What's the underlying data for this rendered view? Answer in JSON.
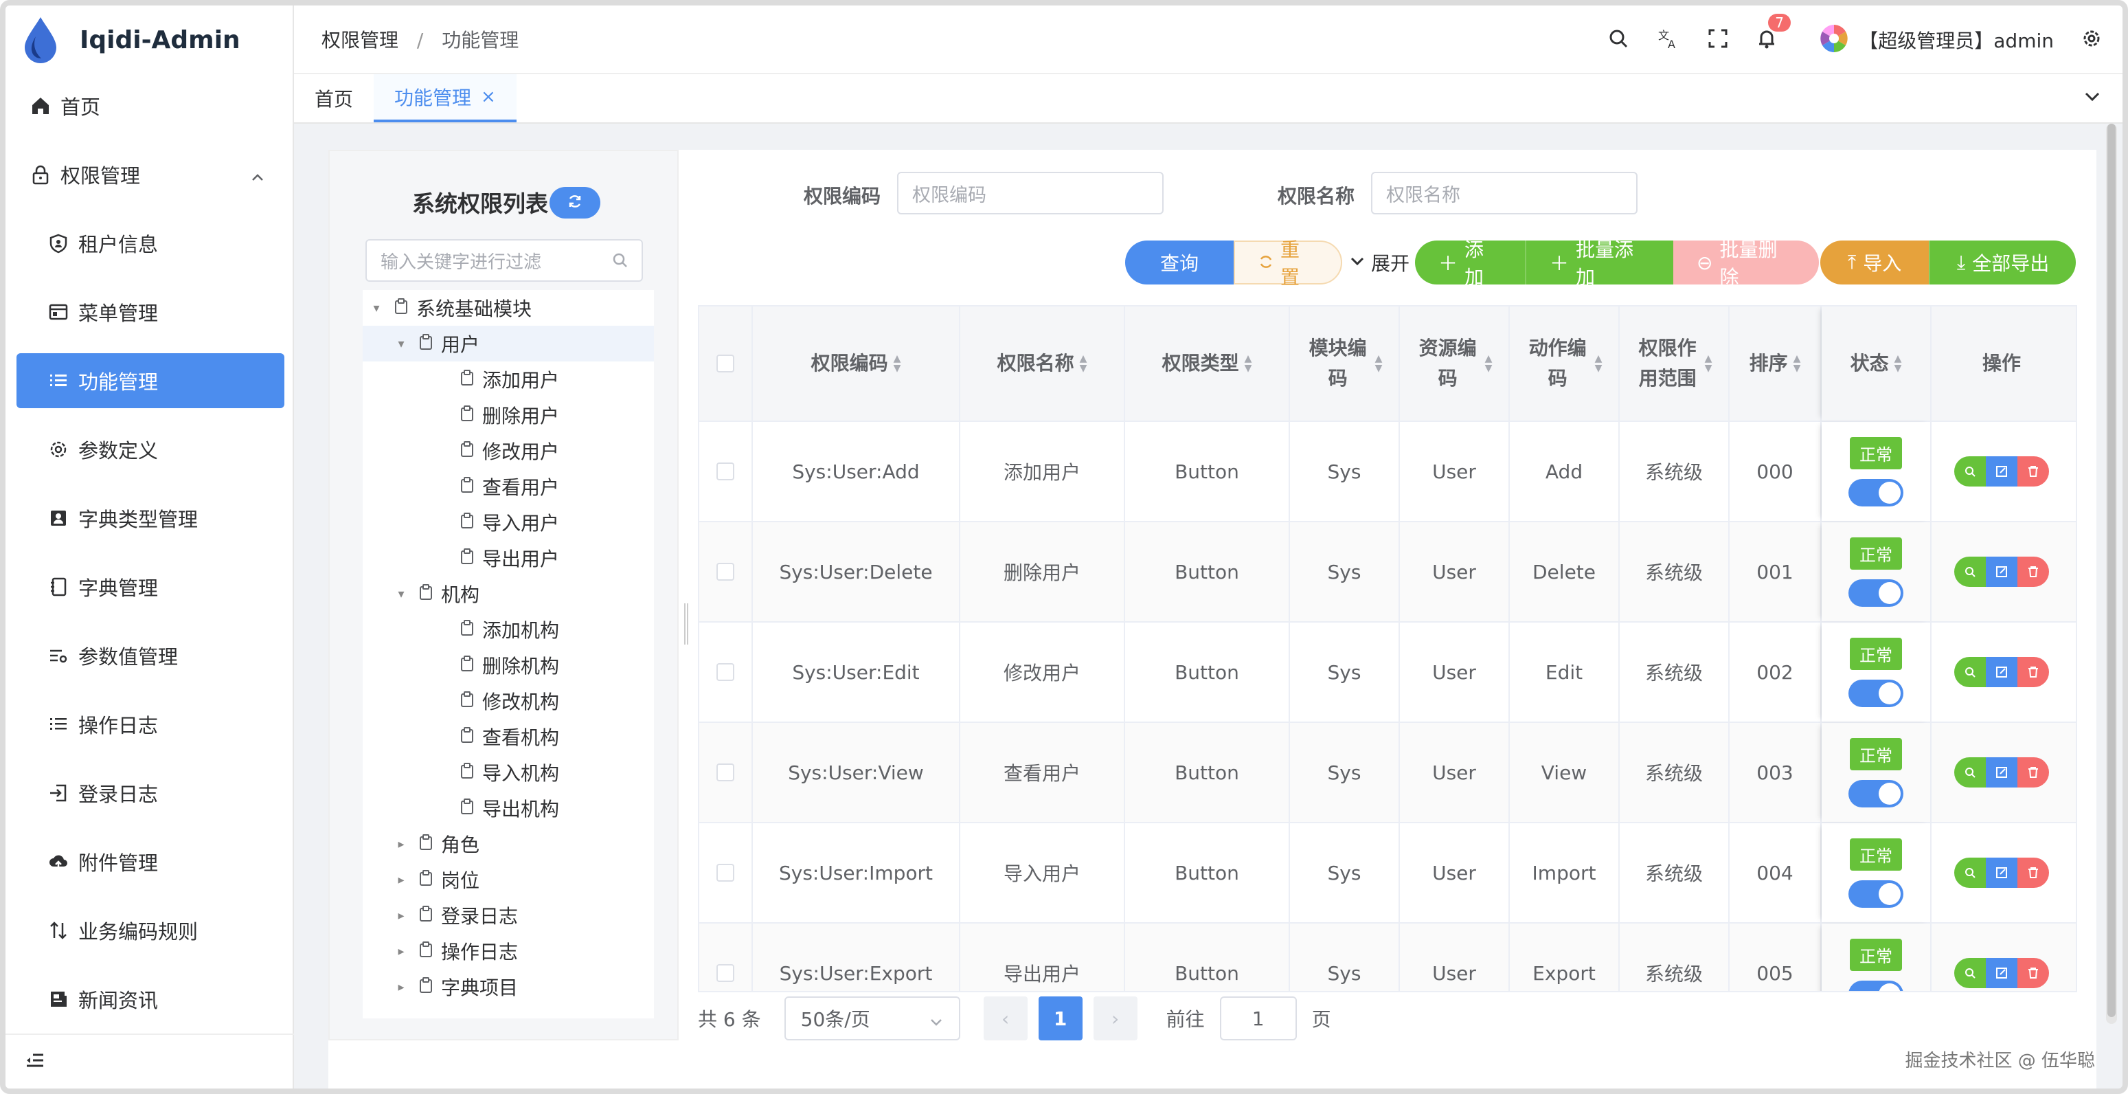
{
  "app": {
    "title": "Iqidi-Admin"
  },
  "sidebar": {
    "items": [
      {
        "label": "首页",
        "icon": "home-icon"
      },
      {
        "label": "权限管理",
        "icon": "lock-icon"
      },
      {
        "label": "租户信息",
        "icon": "shield-icon"
      },
      {
        "label": "菜单管理",
        "icon": "window-icon"
      },
      {
        "label": "功能管理",
        "icon": "list-icon"
      },
      {
        "label": "参数定义",
        "icon": "gear-icon"
      },
      {
        "label": "字典类型管理",
        "icon": "idcard-icon"
      },
      {
        "label": "字典管理",
        "icon": "notebook-icon"
      },
      {
        "label": "参数值管理",
        "icon": "setting-list-icon"
      },
      {
        "label": "操作日志",
        "icon": "list-icon"
      },
      {
        "label": "登录日志",
        "icon": "login-icon"
      },
      {
        "label": "附件管理",
        "icon": "cloud-upload-icon"
      },
      {
        "label": "业务编码规则",
        "icon": "sort-icon"
      },
      {
        "label": "新闻资讯",
        "icon": "news-icon"
      }
    ]
  },
  "header": {
    "breadcrumb": [
      "权限管理",
      "功能管理"
    ],
    "separator": "/",
    "notification_count": "7",
    "user": "【超级管理员】admin"
  },
  "tabs": [
    {
      "label": "首页"
    },
    {
      "label": "功能管理",
      "close": "×"
    }
  ],
  "tree_panel": {
    "title": "系统权限列表",
    "filter_placeholder": "输入关键字进行过滤",
    "nodes": [
      {
        "label": "系统基础模块",
        "level": 0,
        "arrow": "▾"
      },
      {
        "label": "用户",
        "level": 1,
        "arrow": "▾",
        "selected": true
      },
      {
        "label": "添加用户",
        "level": 2,
        "arrow": ""
      },
      {
        "label": "删除用户",
        "level": 2,
        "arrow": ""
      },
      {
        "label": "修改用户",
        "level": 2,
        "arrow": ""
      },
      {
        "label": "查看用户",
        "level": 2,
        "arrow": ""
      },
      {
        "label": "导入用户",
        "level": 2,
        "arrow": ""
      },
      {
        "label": "导出用户",
        "level": 2,
        "arrow": ""
      },
      {
        "label": "机构",
        "level": 1,
        "arrow": "▾"
      },
      {
        "label": "添加机构",
        "level": 2,
        "arrow": ""
      },
      {
        "label": "删除机构",
        "level": 2,
        "arrow": ""
      },
      {
        "label": "修改机构",
        "level": 2,
        "arrow": ""
      },
      {
        "label": "查看机构",
        "level": 2,
        "arrow": ""
      },
      {
        "label": "导入机构",
        "level": 2,
        "arrow": ""
      },
      {
        "label": "导出机构",
        "level": 2,
        "arrow": ""
      },
      {
        "label": "角色",
        "level": 1,
        "arrow": "▸"
      },
      {
        "label": "岗位",
        "level": 1,
        "arrow": "▸"
      },
      {
        "label": "登录日志",
        "level": 1,
        "arrow": "▸"
      },
      {
        "label": "操作日志",
        "level": 1,
        "arrow": "▸"
      },
      {
        "label": "字典项目",
        "level": 1,
        "arrow": "▸"
      }
    ]
  },
  "query": {
    "code_label": "权限编码",
    "code_placeholder": "权限编码",
    "name_label": "权限名称",
    "name_placeholder": "权限名称"
  },
  "toolbar": {
    "query": "查询",
    "reset": "重置",
    "expand": "展开",
    "add": "添加",
    "batch_add": "批量添加",
    "batch_delete": "批量删除",
    "import": "导入",
    "export_all": "全部导出"
  },
  "table": {
    "columns": [
      "权限编码",
      "权限名称",
      "权限类型",
      "模块编码",
      "资源编码",
      "动作编码",
      "权限作用范围",
      "排序",
      "状态",
      "操作"
    ],
    "rows": [
      {
        "code": "Sys:User:Add",
        "name": "添加用户",
        "type": "Button",
        "module": "Sys",
        "resource": "User",
        "action": "Add",
        "scope": "系统级",
        "sort": "000",
        "status": "正常"
      },
      {
        "code": "Sys:User:Delete",
        "name": "删除用户",
        "type": "Button",
        "module": "Sys",
        "resource": "User",
        "action": "Delete",
        "scope": "系统级",
        "sort": "001",
        "status": "正常"
      },
      {
        "code": "Sys:User:Edit",
        "name": "修改用户",
        "type": "Button",
        "module": "Sys",
        "resource": "User",
        "action": "Edit",
        "scope": "系统级",
        "sort": "002",
        "status": "正常"
      },
      {
        "code": "Sys:User:View",
        "name": "查看用户",
        "type": "Button",
        "module": "Sys",
        "resource": "User",
        "action": "View",
        "scope": "系统级",
        "sort": "003",
        "status": "正常"
      },
      {
        "code": "Sys:User:Import",
        "name": "导入用户",
        "type": "Button",
        "module": "Sys",
        "resource": "User",
        "action": "Import",
        "scope": "系统级",
        "sort": "004",
        "status": "正常"
      },
      {
        "code": "Sys:User:Export",
        "name": "导出用户",
        "type": "Button",
        "module": "Sys",
        "resource": "User",
        "action": "Export",
        "scope": "系统级",
        "sort": "005",
        "status": "正常"
      }
    ]
  },
  "pagination": {
    "total": "共 6 条",
    "page_size": "50条/页",
    "current": "1",
    "goto_prefix": "前往",
    "goto_value": "1",
    "goto_suffix": "页"
  },
  "watermark": "掘金技术社区 @ 伍华聪",
  "colors": {
    "primary": "#4c8dee",
    "success": "#67c23a",
    "warning": "#e6a23c",
    "danger": "#f56c6c"
  }
}
